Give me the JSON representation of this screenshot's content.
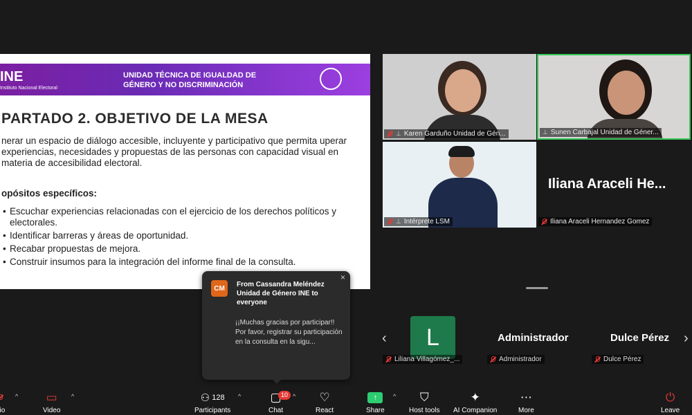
{
  "slide": {
    "logo": "INE",
    "logo_sub": "Instituto Nacional Electoral",
    "header_title": "UNIDAD TÉCNICA DE IGUALDAD DE GÉNERO Y NO DISCRIMINACIÓN",
    "title": "PARTADO 2. OBJETIVO DE LA MESA",
    "intro": "nerar un espacio de diálogo accesible, incluyente y participativo que permita uperar experiencias, necesidades y propuestas de las personas con capacidad visual en materia de accesibilidad electoral.",
    "subheading": "opósitos específicos:",
    "items": [
      "Escuchar experiencias relacionadas con el ejercicio de los derechos políticos y electorales.",
      "Identificar barreras y áreas de oportunidad.",
      "Recabar propuestas de mejora.",
      "Construir insumos para la integración del informe final de la consulta."
    ]
  },
  "tiles": {
    "t1_name": "Karen Garduño Unidad de Gén...",
    "t2_name": "Sunen Carbajal Unidad de Géner...",
    "t3_name": "Intérprete LSM",
    "t4_display": "Iliana Araceli He...",
    "t4_name": "Iliana Araceli Hernandez Gomez"
  },
  "gallery": {
    "p1_initial": "L",
    "p1_name": "Liliana Villagómez_...",
    "p2_display": "Administrador",
    "p2_name": "Administrador",
    "p3_display": "Dulce Pérez",
    "p3_name": "Dulce Pérez"
  },
  "chat": {
    "avatar": "CM",
    "from": "From Cassandra Meléndez Unidad de Género INE to everyone",
    "message": "¡¡Muchas gracias por participar!! Por favor, registrar su participación en la consulta en la sigu...",
    "close": "×"
  },
  "toolbar": {
    "audio": "dio",
    "video": "Video",
    "participants": "Participants",
    "participants_count": "128",
    "chat": "Chat",
    "chat_badge": "10",
    "react": "React",
    "share": "Share",
    "host_tools": "Host tools",
    "ai_companion": "AI Companion",
    "more": "More",
    "leave": "Leave"
  },
  "colors": {
    "active_speaker_border": "#35c759",
    "slide_header": "#7b1fa2",
    "leave": "#e53935",
    "share": "#2ecc71"
  }
}
